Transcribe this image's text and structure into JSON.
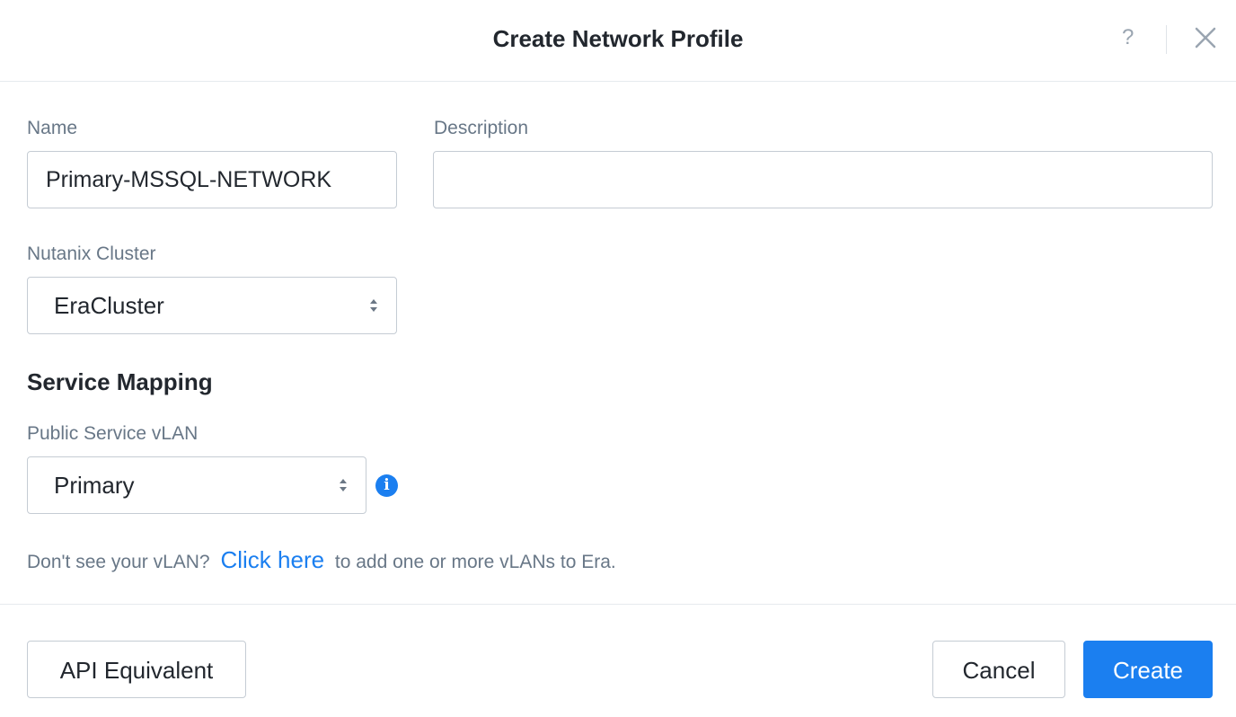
{
  "dialog": {
    "title": "Create Network Profile",
    "help_icon": "question-mark-icon",
    "help_label": "?",
    "close_icon": "close-icon"
  },
  "form": {
    "name": {
      "label": "Name",
      "value": "Primary-MSSQL-NETWORK",
      "placeholder": ""
    },
    "description": {
      "label": "Description",
      "value": "",
      "placeholder": ""
    },
    "cluster": {
      "label": "Nutanix Cluster",
      "selected": "EraCluster"
    },
    "service_mapping": {
      "heading": "Service Mapping",
      "public_vlan": {
        "label": "Public Service vLAN",
        "selected": "Primary",
        "info_icon": "info-icon",
        "info_glyph": "i"
      }
    },
    "vlan_note": {
      "prefix": "Don't see your vLAN?",
      "link": "Click here",
      "suffix": "to add one or more vLANs to Era."
    }
  },
  "footer": {
    "api_button": "API Equivalent",
    "cancel_button": "Cancel",
    "create_button": "Create"
  },
  "colors": {
    "accent": "#1b7ff0",
    "label": "#687787",
    "text": "#22272e",
    "border": "#c5ccd4"
  }
}
